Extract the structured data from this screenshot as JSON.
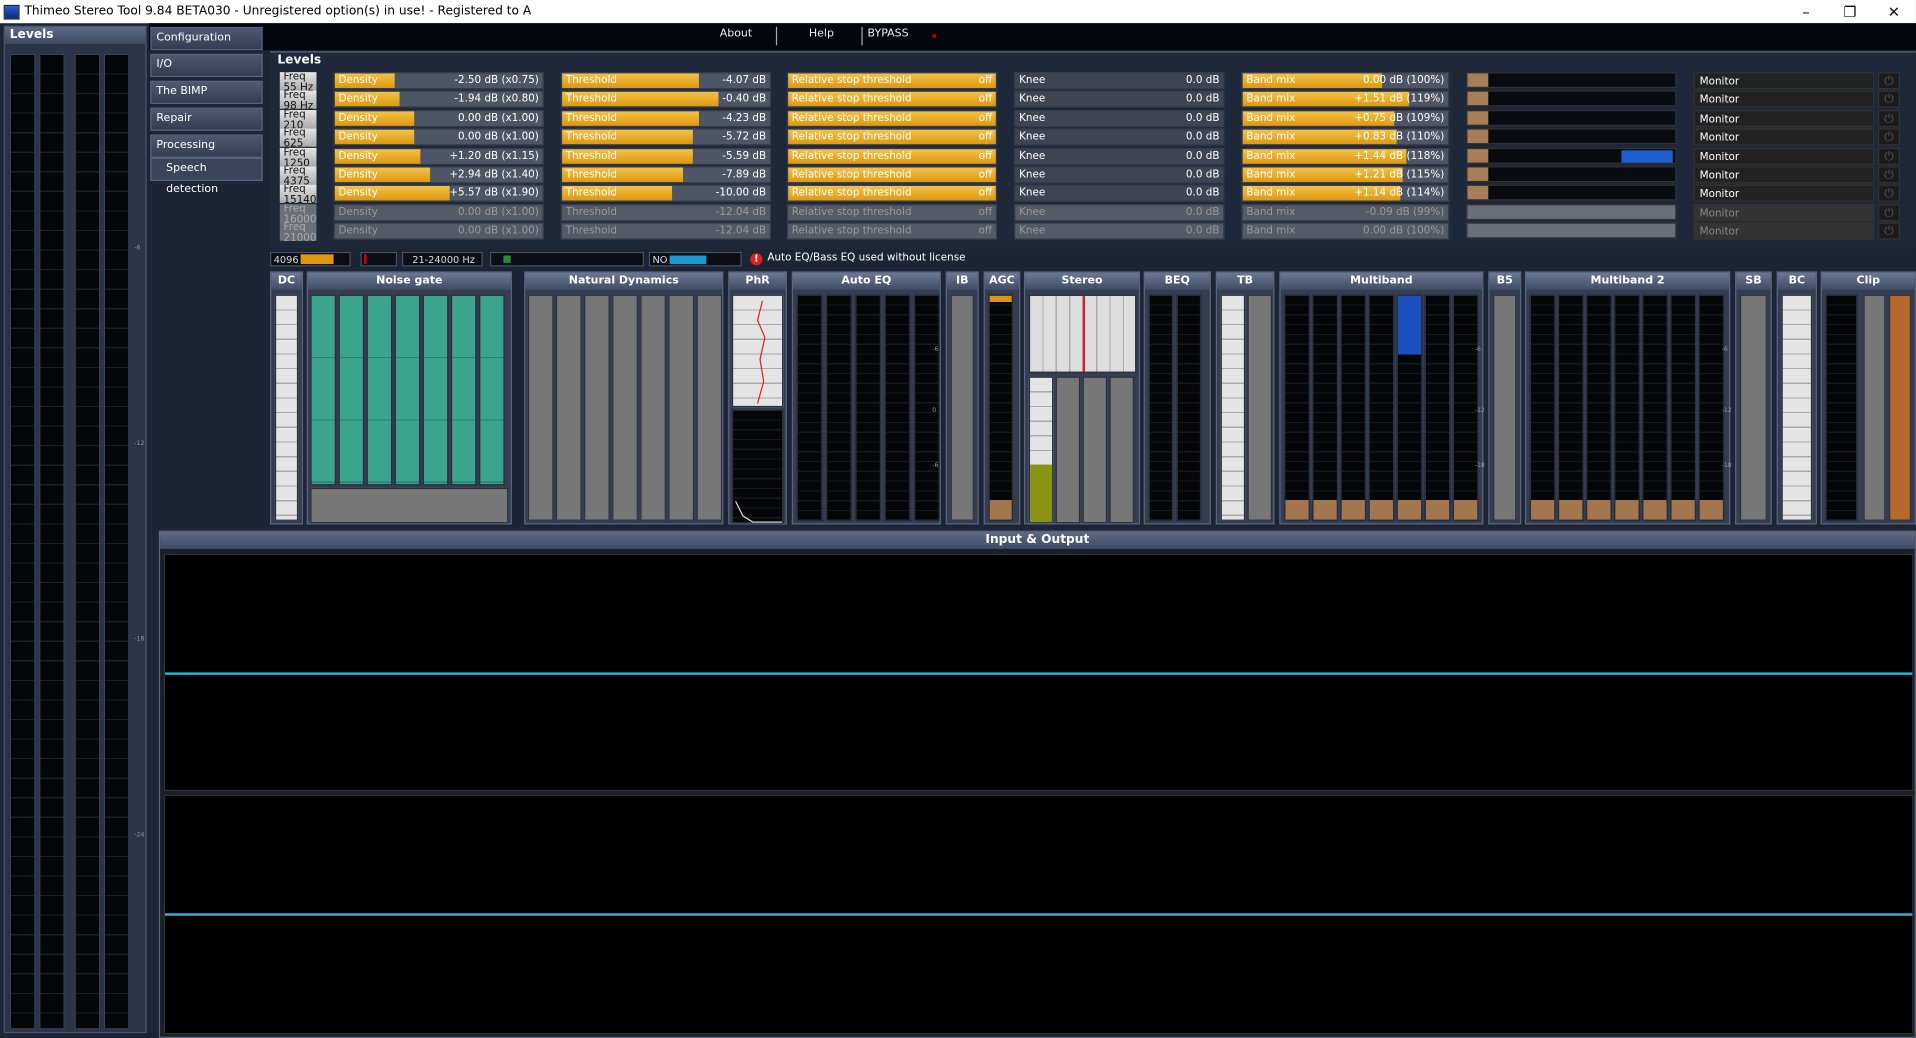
{
  "window": {
    "title": "Thimeo Stereo Tool 9.84 BETA030 - Unregistered option(s) in use! - Registered to A",
    "min": "–",
    "max": "❐",
    "close": "✕"
  },
  "topmenu": {
    "about": "About",
    "help": "Help",
    "bypass": "BYPASS"
  },
  "left_panel": {
    "title": "Levels",
    "ticks": [
      "-6",
      "-12",
      "-18",
      "-24"
    ]
  },
  "nav": {
    "items": [
      "Configuration",
      "I/O",
      "The BIMP",
      "Repair",
      "Processing"
    ],
    "sub": "Speech detection"
  },
  "levels": {
    "title": "Levels",
    "rows": [
      {
        "freq": "Freq 55 Hz",
        "density": "Density",
        "density_val": "-2.50 dB (x0.75)",
        "density_fill": 0.29,
        "threshold": "Threshold",
        "threshold_val": "-4.07 dB",
        "threshold_fill": 0.66,
        "rel": "Relative stop threshold",
        "rel_val": "off",
        "knee": "Knee",
        "knee_val": "0.0 dB",
        "bandmix": "Band mix",
        "bandmix_val": "0.00 dB (100%)",
        "bandmix_fill": 0.68,
        "monitor": "Monitor",
        "enabled": true
      },
      {
        "freq": "Freq 98 Hz",
        "density": "Density",
        "density_val": "-1.94 dB (x0.80)",
        "density_fill": 0.31,
        "threshold": "Threshold",
        "threshold_val": "-0.40 dB",
        "threshold_fill": 0.75,
        "rel": "Relative stop threshold",
        "rel_val": "off",
        "knee": "Knee",
        "knee_val": "0.0 dB",
        "bandmix": "Band mix",
        "bandmix_val": "+1.51 dB (119%)",
        "bandmix_fill": 0.81,
        "monitor": "Monitor",
        "enabled": true
      },
      {
        "freq": "Freq 210 Hz",
        "density": "Density",
        "density_val": "0.00 dB (x1.00)",
        "density_fill": 0.38,
        "threshold": "Threshold",
        "threshold_val": "-4.23 dB",
        "threshold_fill": 0.66,
        "rel": "Relative stop threshold",
        "rel_val": "off",
        "knee": "Knee",
        "knee_val": "0.0 dB",
        "bandmix": "Band mix",
        "bandmix_val": "+0.75 dB (109%)",
        "bandmix_fill": 0.74,
        "monitor": "Monitor",
        "enabled": true
      },
      {
        "freq": "Freq 625 Hz",
        "density": "Density",
        "density_val": "0.00 dB (x1.00)",
        "density_fill": 0.38,
        "threshold": "Threshold",
        "threshold_val": "-5.72 dB",
        "threshold_fill": 0.63,
        "rel": "Relative stop threshold",
        "rel_val": "off",
        "knee": "Knee",
        "knee_val": "0.0 dB",
        "bandmix": "Band mix",
        "bandmix_val": "+0.83 dB (110%)",
        "bandmix_fill": 0.75,
        "monitor": "Monitor",
        "enabled": true
      },
      {
        "freq": "Freq 1250 Hz",
        "density": "Density",
        "density_val": "+1.20 dB (x1.15)",
        "density_fill": 0.41,
        "threshold": "Threshold",
        "threshold_val": "-5.59 dB",
        "threshold_fill": 0.63,
        "rel": "Relative stop threshold",
        "rel_val": "off",
        "knee": "Knee",
        "knee_val": "0.0 dB",
        "bandmix": "Band mix",
        "bandmix_val": "+1.44 dB (118%)",
        "bandmix_fill": 0.8,
        "monitor": "Monitor",
        "enabled": true
      },
      {
        "freq": "Freq 4375 Hz",
        "density": "Density",
        "density_val": "+2.94 dB (x1.40)",
        "density_fill": 0.46,
        "threshold": "Threshold",
        "threshold_val": "-7.89 dB",
        "threshold_fill": 0.58,
        "rel": "Relative stop threshold",
        "rel_val": "off",
        "knee": "Knee",
        "knee_val": "0.0 dB",
        "bandmix": "Band mix",
        "bandmix_val": "+1.21 dB (115%)",
        "bandmix_fill": 0.78,
        "monitor": "Monitor",
        "enabled": true
      },
      {
        "freq": "Freq 15140 Hz",
        "density": "Density",
        "density_val": "+5.57 dB (x1.90)",
        "density_fill": 0.55,
        "threshold": "Threshold",
        "threshold_val": "-10.00 dB",
        "threshold_fill": 0.53,
        "rel": "Relative stop threshold",
        "rel_val": "off",
        "knee": "Knee",
        "knee_val": "0.0 dB",
        "bandmix": "Band mix",
        "bandmix_val": "+1.14 dB (114%)",
        "bandmix_fill": 0.77,
        "monitor": "Monitor",
        "enabled": true
      },
      {
        "freq": "Freq 16000 Hz",
        "density": "Density",
        "density_val": "0.00 dB (x1.00)",
        "density_fill": 0.38,
        "threshold": "Threshold",
        "threshold_val": "-12.04 dB",
        "threshold_fill": 0.49,
        "rel": "Relative stop threshold",
        "rel_val": "off",
        "knee": "Knee",
        "knee_val": "0.0 dB",
        "bandmix": "Band mix",
        "bandmix_val": "-0.09 dB (99%)",
        "bandmix_fill": 0.67,
        "monitor": "Monitor",
        "enabled": false
      },
      {
        "freq": "Freq 21000 Hz",
        "density": "Density",
        "density_val": "0.00 dB (x1.00)",
        "density_fill": 0.38,
        "threshold": "Threshold",
        "threshold_val": "-12.04 dB",
        "threshold_fill": 0.49,
        "rel": "Relative stop threshold",
        "rel_val": "off",
        "knee": "Knee",
        "knee_val": "0.0 dB",
        "bandmix": "Band mix",
        "bandmix_val": "0.00 dB (100%)",
        "bandmix_fill": 0.68,
        "monitor": "Monitor",
        "enabled": false
      }
    ]
  },
  "status": {
    "fft": "4096",
    "range": "21-24000 Hz",
    "no": "NO",
    "warning": "Auto EQ/Bass EQ used without license"
  },
  "modules": [
    "DC",
    "Noise gate",
    "Natural Dynamics",
    "PhR",
    "Auto EQ",
    "IB",
    "AGC",
    "Stereo",
    "BEQ",
    "TB",
    "Multiband",
    "B5",
    "Multiband 2",
    "SB",
    "BC",
    "Clip"
  ],
  "module_ticks": [
    "-6",
    "-12",
    "0",
    "-6",
    "-12",
    "-18"
  ],
  "io": {
    "title": "Input & Output"
  },
  "colors": {
    "accent": "#dd9810",
    "teal": "#3aa48c",
    "cyan": "#26b8d6",
    "brown": "#a2774f"
  }
}
